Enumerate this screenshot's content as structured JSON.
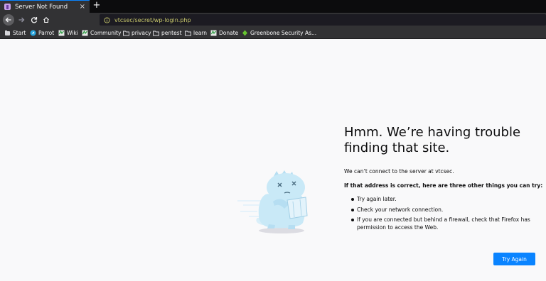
{
  "browser": {
    "tab": {
      "title": "Server Not Found",
      "close_glyph": "×"
    },
    "new_tab_glyph": "+",
    "url": "vtcsec/secret/wp-login.php",
    "accent_color": "#0a84ff",
    "url_text_color": "#c7c76b"
  },
  "bookmarks": [
    {
      "label": "Start",
      "icon": "bookmark-folder-icon"
    },
    {
      "label": "Parrot",
      "icon": "parrot-logo-icon"
    },
    {
      "label": "Wiki",
      "icon": "wiki-favicon-icon"
    },
    {
      "label": "Community",
      "icon": "community-favicon-icon"
    },
    {
      "label": "privacy",
      "icon": "folder-icon"
    },
    {
      "label": "pentest",
      "icon": "folder-icon"
    },
    {
      "label": "learn",
      "icon": "folder-icon"
    },
    {
      "label": "Donate",
      "icon": "donate-favicon-icon"
    },
    {
      "label": "Greenbone Security As...",
      "icon": "greenbone-favicon-icon"
    }
  ],
  "error": {
    "title": "Hmm. We’re having trouble finding that site.",
    "message": "We can’t connect to the server at vtcsec.",
    "subheading": "If that address is correct, here are three other things you can try:",
    "suggestions": [
      "Try again later.",
      "Check your network connection.",
      "If you are connected but behind a firewall, check that Firefox has permission to access the Web."
    ],
    "try_again_label": "Try Again",
    "illustration": "confused-dinosaur-illustration"
  }
}
